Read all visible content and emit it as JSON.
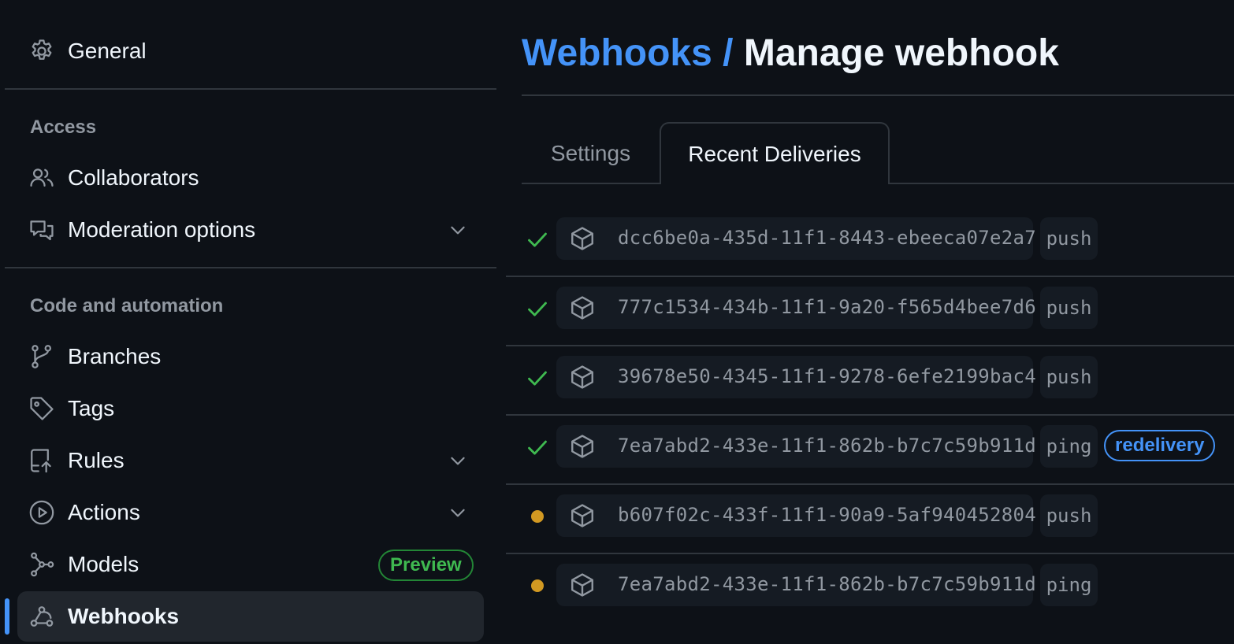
{
  "sidebar": {
    "general": "General",
    "access_heading": "Access",
    "collaborators": "Collaborators",
    "moderation": "Moderation options",
    "code_heading": "Code and automation",
    "branches": "Branches",
    "tags": "Tags",
    "rules": "Rules",
    "actions": "Actions",
    "models": "Models",
    "models_badge": "Preview",
    "webhooks": "Webhooks"
  },
  "header": {
    "breadcrumb": "Webhooks",
    "separator": "/",
    "title": "Manage webhook"
  },
  "tabs": {
    "settings": "Settings",
    "recent": "Recent Deliveries"
  },
  "deliveries": [
    {
      "status": "success",
      "guid": "dcc6be0a-435d-11f1-8443-ebeeca07e2a7",
      "event": "push"
    },
    {
      "status": "success",
      "guid": "777c1534-434b-11f1-9a20-f565d4bee7d6",
      "event": "push"
    },
    {
      "status": "success",
      "guid": "39678e50-4345-11f1-9278-6efe2199bac4",
      "event": "push"
    },
    {
      "status": "success",
      "guid": "7ea7abd2-433e-11f1-862b-b7c7c59b911d",
      "event": "ping",
      "badge": "redelivery"
    },
    {
      "status": "pending",
      "guid": "b607f02c-433f-11f1-90a9-5af940452804",
      "event": "push"
    },
    {
      "status": "pending",
      "guid": "7ea7abd2-433e-11f1-862b-b7c7c59b911d",
      "event": "ping"
    }
  ],
  "colors": {
    "background": "#0d1117",
    "accent": "#4493f8",
    "success": "#3fb950",
    "pending": "#d29922",
    "muted": "#9198a1",
    "border": "#30363d"
  }
}
